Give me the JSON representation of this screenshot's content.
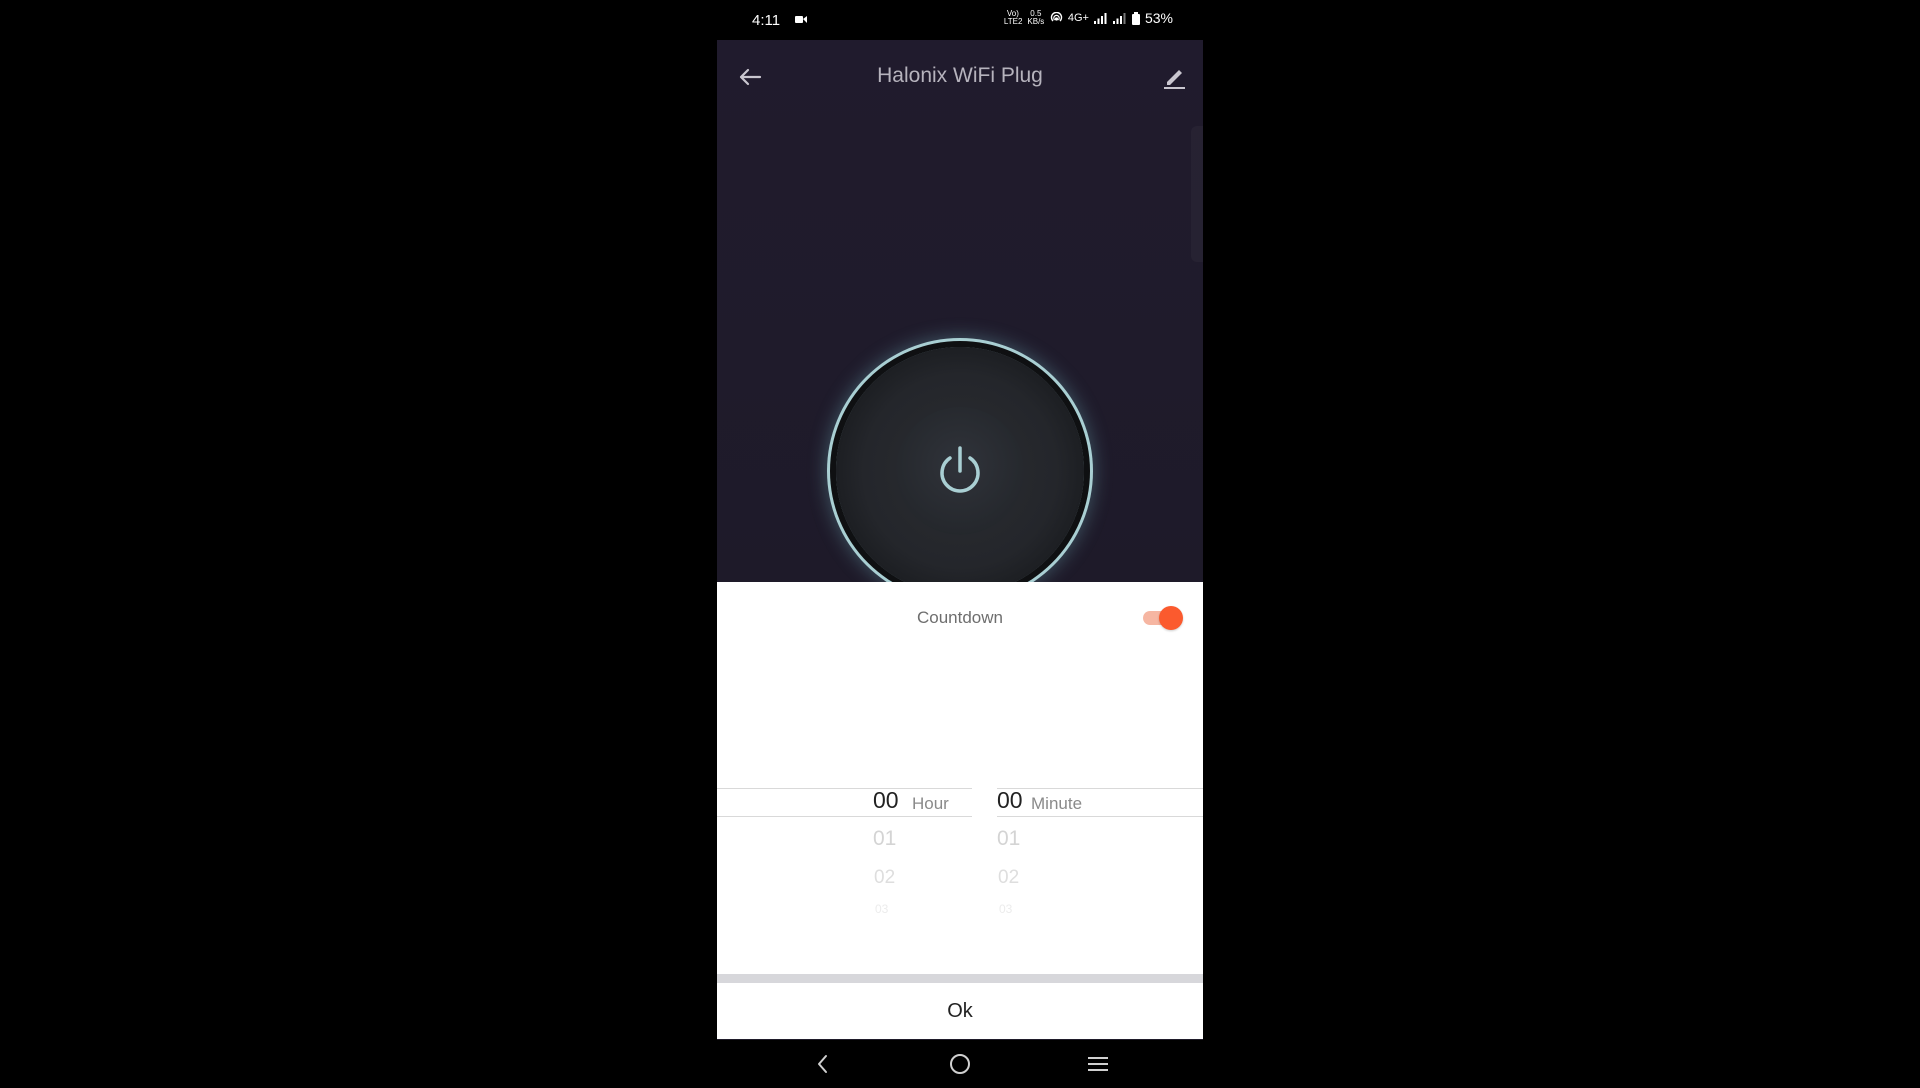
{
  "status_bar": {
    "time": "4:11",
    "volte": "Vo) LTE2",
    "speed": "0.5 KB/s",
    "network": "4G+",
    "battery": "53%",
    "icons": [
      "video-record-icon",
      "hotspot-icon",
      "signal-icon",
      "signal-icon-2",
      "battery-icon"
    ]
  },
  "app_bar": {
    "title": "Halonix WiFi Plug",
    "icons": [
      "back-arrow-icon",
      "edit-pencil-icon"
    ]
  },
  "device": {
    "power_icon": "power-icon",
    "accent_color": "#a9cfd3"
  },
  "countdown": {
    "title": "Countdown",
    "toggle_on": true,
    "toggle_color": "#fb5a2e",
    "hour": {
      "selected": "00",
      "unit": "Hour",
      "options": [
        "01",
        "02",
        "03"
      ]
    },
    "minute": {
      "selected": "00",
      "unit": "Minute",
      "options": [
        "01",
        "02",
        "03"
      ]
    },
    "ok_label": "Ok"
  },
  "nav_bar": {
    "icons": [
      "nav-back-icon",
      "nav-home-icon",
      "nav-recents-icon"
    ]
  }
}
